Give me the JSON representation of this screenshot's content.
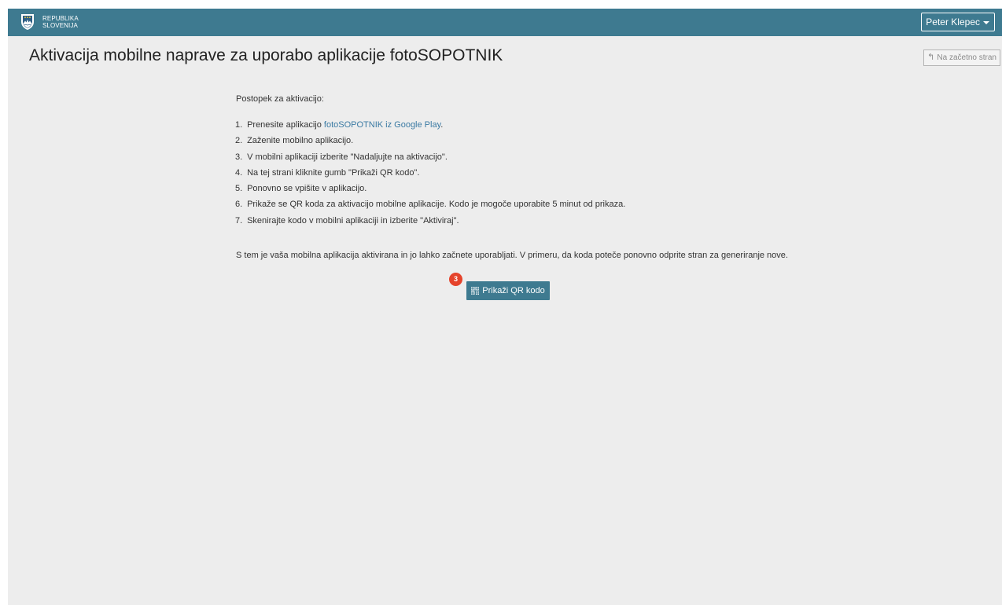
{
  "header": {
    "brand_line1": "REPUBLIKA",
    "brand_line2": "SLOVENIJA",
    "crest_icon": "coat-of-arms-icon",
    "user_name": "Peter Klepec",
    "bar_color": "#3e7a90"
  },
  "page": {
    "title": "Aktivacija mobilne naprave za uporabo aplikacije fotoSOPOTNIK",
    "home_link_label": "Na začetno stran",
    "home_link_icon": "return-arrow-icon"
  },
  "content": {
    "intro": "Postopek za aktivacijo:",
    "steps": [
      {
        "num": "1.",
        "text": "Prenesite aplikacijo ",
        "link": "fotoSOPOTNIK iz Google Play",
        "suffix": "."
      },
      {
        "num": "2.",
        "text": "Zaženite mobilno aplikacijo."
      },
      {
        "num": "3.",
        "text": "V mobilni aplikaciji izberite \"Nadaljujte na aktivacijo\"."
      },
      {
        "num": "4.",
        "text": "Na tej strani kliknite gumb \"Prikaži QR kodo\"."
      },
      {
        "num": "5.",
        "text": "Ponovno se vpišite v aplikacijo."
      },
      {
        "num": "6.",
        "text": "Prikaže se QR koda za aktivacijo mobilne aplikacije. Kodo je mogoče uporabite 5 minut od prikaza."
      },
      {
        "num": "7.",
        "text": "Skenirajte kodo v mobilni aplikaciji in izberite \"Aktiviraj\"."
      }
    ],
    "summary": "S tem je vaša mobilna aplikacija aktivirana in jo lahko začnete uporabljati. V primeru, da koda poteče ponovno odprite stran za generiranje nove."
  },
  "action": {
    "button_label": "Prikaži QR kodo",
    "button_icon": "qr-code-icon",
    "badge_number": "3",
    "badge_color": "#e5432b"
  }
}
